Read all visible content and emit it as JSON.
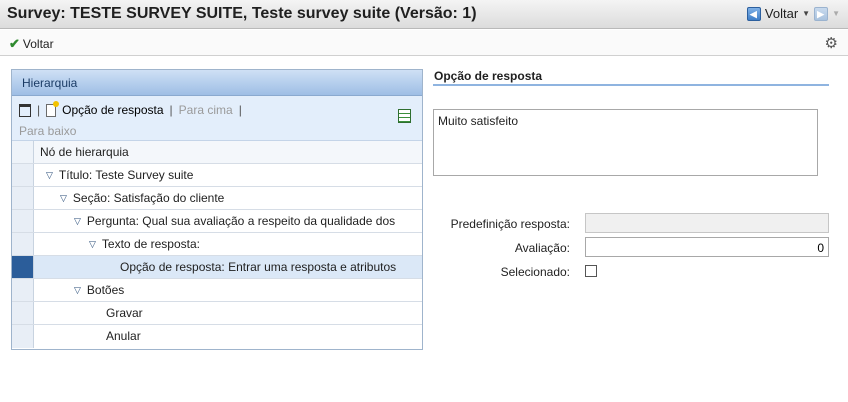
{
  "window": {
    "title": "Survey: TESTE SURVEY SUITE, Teste survey suite (Versão: 1)",
    "nav_back_label": "Voltar"
  },
  "toolbar": {
    "back_label": "Voltar"
  },
  "hierarchy": {
    "panel_title": "Hierarquia",
    "tools": {
      "add_option_label": "Opção de resposta",
      "move_up_label": "Para cima",
      "move_down_label": "Para baixo"
    },
    "column_header": "Nó de hierarquia",
    "rows": [
      {
        "label": "Título: Teste Survey suite"
      },
      {
        "label": "Seção: Satisfação do cliente"
      },
      {
        "label": "Pergunta: Qual sua avaliação a respeito da qualidade dos"
      },
      {
        "label": "Texto de resposta:"
      },
      {
        "label": "Opção de resposta: Entrar uma resposta e atributos"
      },
      {
        "label": "Botões"
      },
      {
        "label": "Gravar"
      },
      {
        "label": "Anular"
      }
    ]
  },
  "detail": {
    "section_title": "Opção de resposta",
    "text_value": "Muito satisfeito",
    "fields": {
      "predef_label": "Predefinição resposta:",
      "predef_value": "",
      "rating_label": "Avaliação:",
      "rating_value": "0",
      "selected_label": "Selecionado:"
    }
  }
}
